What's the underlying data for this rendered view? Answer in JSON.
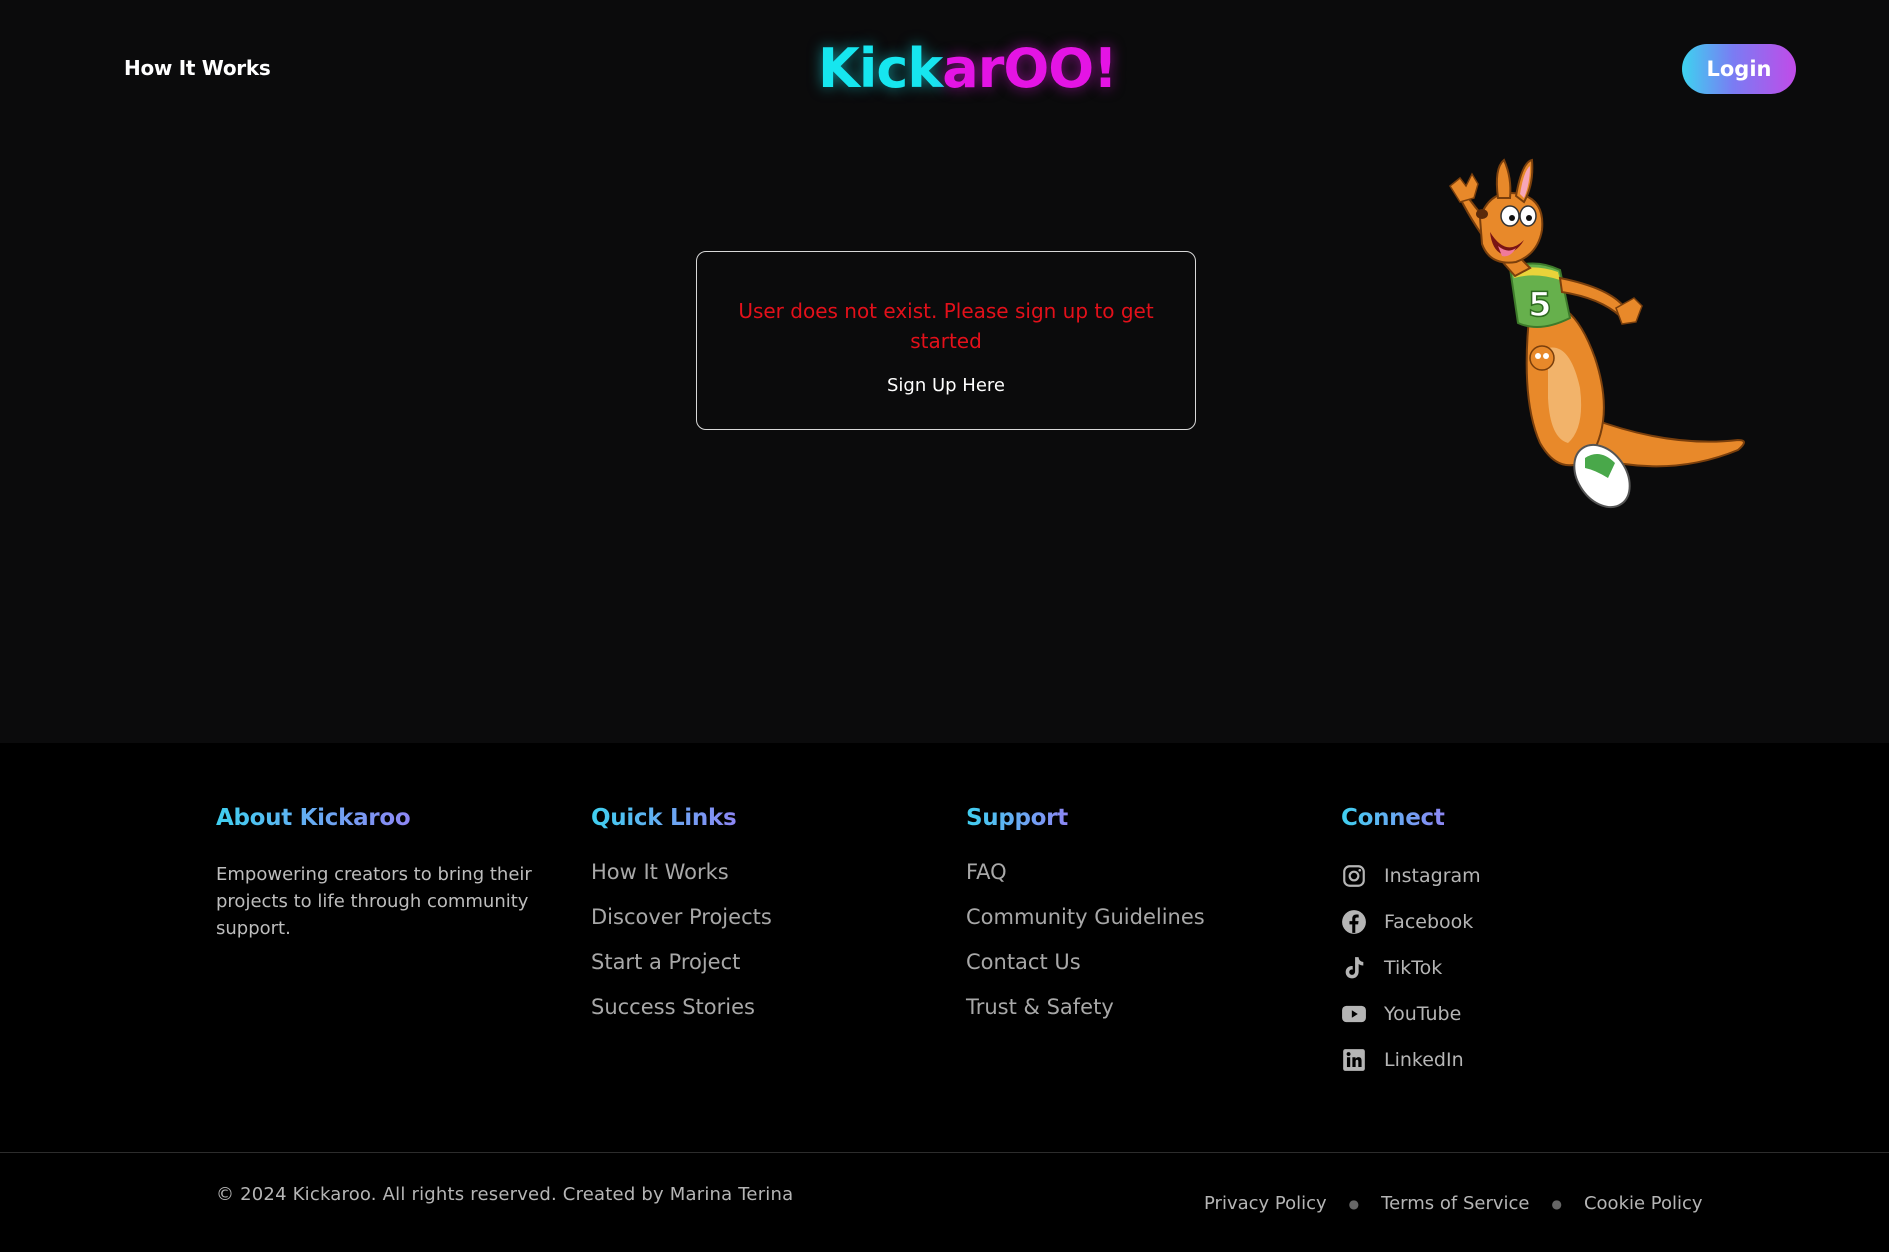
{
  "header": {
    "nav_link": "How It Works",
    "logo_part1": "Kick",
    "logo_part2": "arOO!",
    "login_label": "Login",
    "colors": {
      "cyan": "#16e6ef",
      "magenta": "#e414e4"
    }
  },
  "message": {
    "error_text": "User does not exist. Please sign up to get started",
    "signup_link": "Sign Up Here",
    "error_color": "#e3101a"
  },
  "mascot": {
    "jersey_number": "5"
  },
  "footer": {
    "about": {
      "title": "About Kickaroo",
      "text": "Empowering creators to bring their projects to life through community support."
    },
    "quick_links": {
      "title": "Quick Links",
      "items": [
        "How It Works",
        "Discover Projects",
        "Start a Project",
        "Success Stories"
      ]
    },
    "support": {
      "title": "Support",
      "items": [
        "FAQ",
        "Community Guidelines",
        "Contact Us",
        "Trust & Safety"
      ]
    },
    "connect": {
      "title": "Connect",
      "items": [
        {
          "label": "Instagram",
          "icon": "instagram-icon"
        },
        {
          "label": "Facebook",
          "icon": "facebook-icon"
        },
        {
          "label": "TikTok",
          "icon": "tiktok-icon"
        },
        {
          "label": "YouTube",
          "icon": "youtube-icon"
        },
        {
          "label": "LinkedIn",
          "icon": "linkedin-icon"
        }
      ]
    },
    "copyright": "© 2024 Kickaroo. All rights reserved. Created by Marina Terina",
    "legal": [
      "Privacy Policy",
      "Terms of Service",
      "Cookie Policy"
    ]
  }
}
